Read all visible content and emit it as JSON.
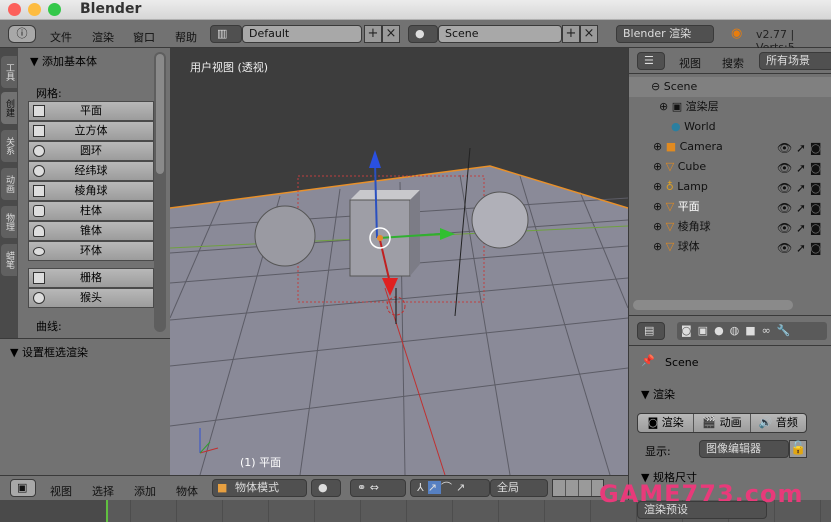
{
  "app": {
    "title": "Blender"
  },
  "top_header": {
    "menus": [
      "文件",
      "渲染",
      "窗口",
      "帮助"
    ],
    "layout": "Default",
    "scene": "Scene",
    "engine": "Blender 渲染",
    "version": "v2.77 | Verts:5"
  },
  "tool_tabs": [
    "工具",
    "创建",
    "关系",
    "动画",
    "物理",
    "蜡笔"
  ],
  "tool_panel": {
    "section": "▼ 添加基本体",
    "mesh_label": "网格:",
    "mesh_items": [
      "平面",
      "立方体",
      "圆环",
      "经纬球",
      "棱角球",
      "柱体",
      "锥体",
      "环体"
    ],
    "extra_items": [
      "栅格",
      "猴头"
    ],
    "curve_label": "曲线:",
    "section2": "▼ 设置框选渲染"
  },
  "viewport": {
    "view_label": "用户视图 (透视)",
    "object_label": "(1) 平面"
  },
  "outliner": {
    "menus": [
      "视图",
      "搜索"
    ],
    "filter": "所有场景",
    "items": [
      "Scene",
      "渲染层",
      "World",
      "Camera",
      "Cube",
      "Lamp",
      "平面",
      "棱角球",
      "球体"
    ]
  },
  "properties": {
    "context": "Scene",
    "panel1": "▼ 渲染",
    "buttons": [
      "渲染",
      "动画",
      "音频"
    ],
    "display_label": "显示:",
    "display_value": "图像编辑器",
    "panel2": "▼ 规格尺寸",
    "preset": "渲染预设"
  },
  "bottom_header": {
    "menus": [
      "视图",
      "选择",
      "添加",
      "物体"
    ],
    "mode": "物体模式",
    "orientation": "全局"
  },
  "watermark": "GAME773.com"
}
